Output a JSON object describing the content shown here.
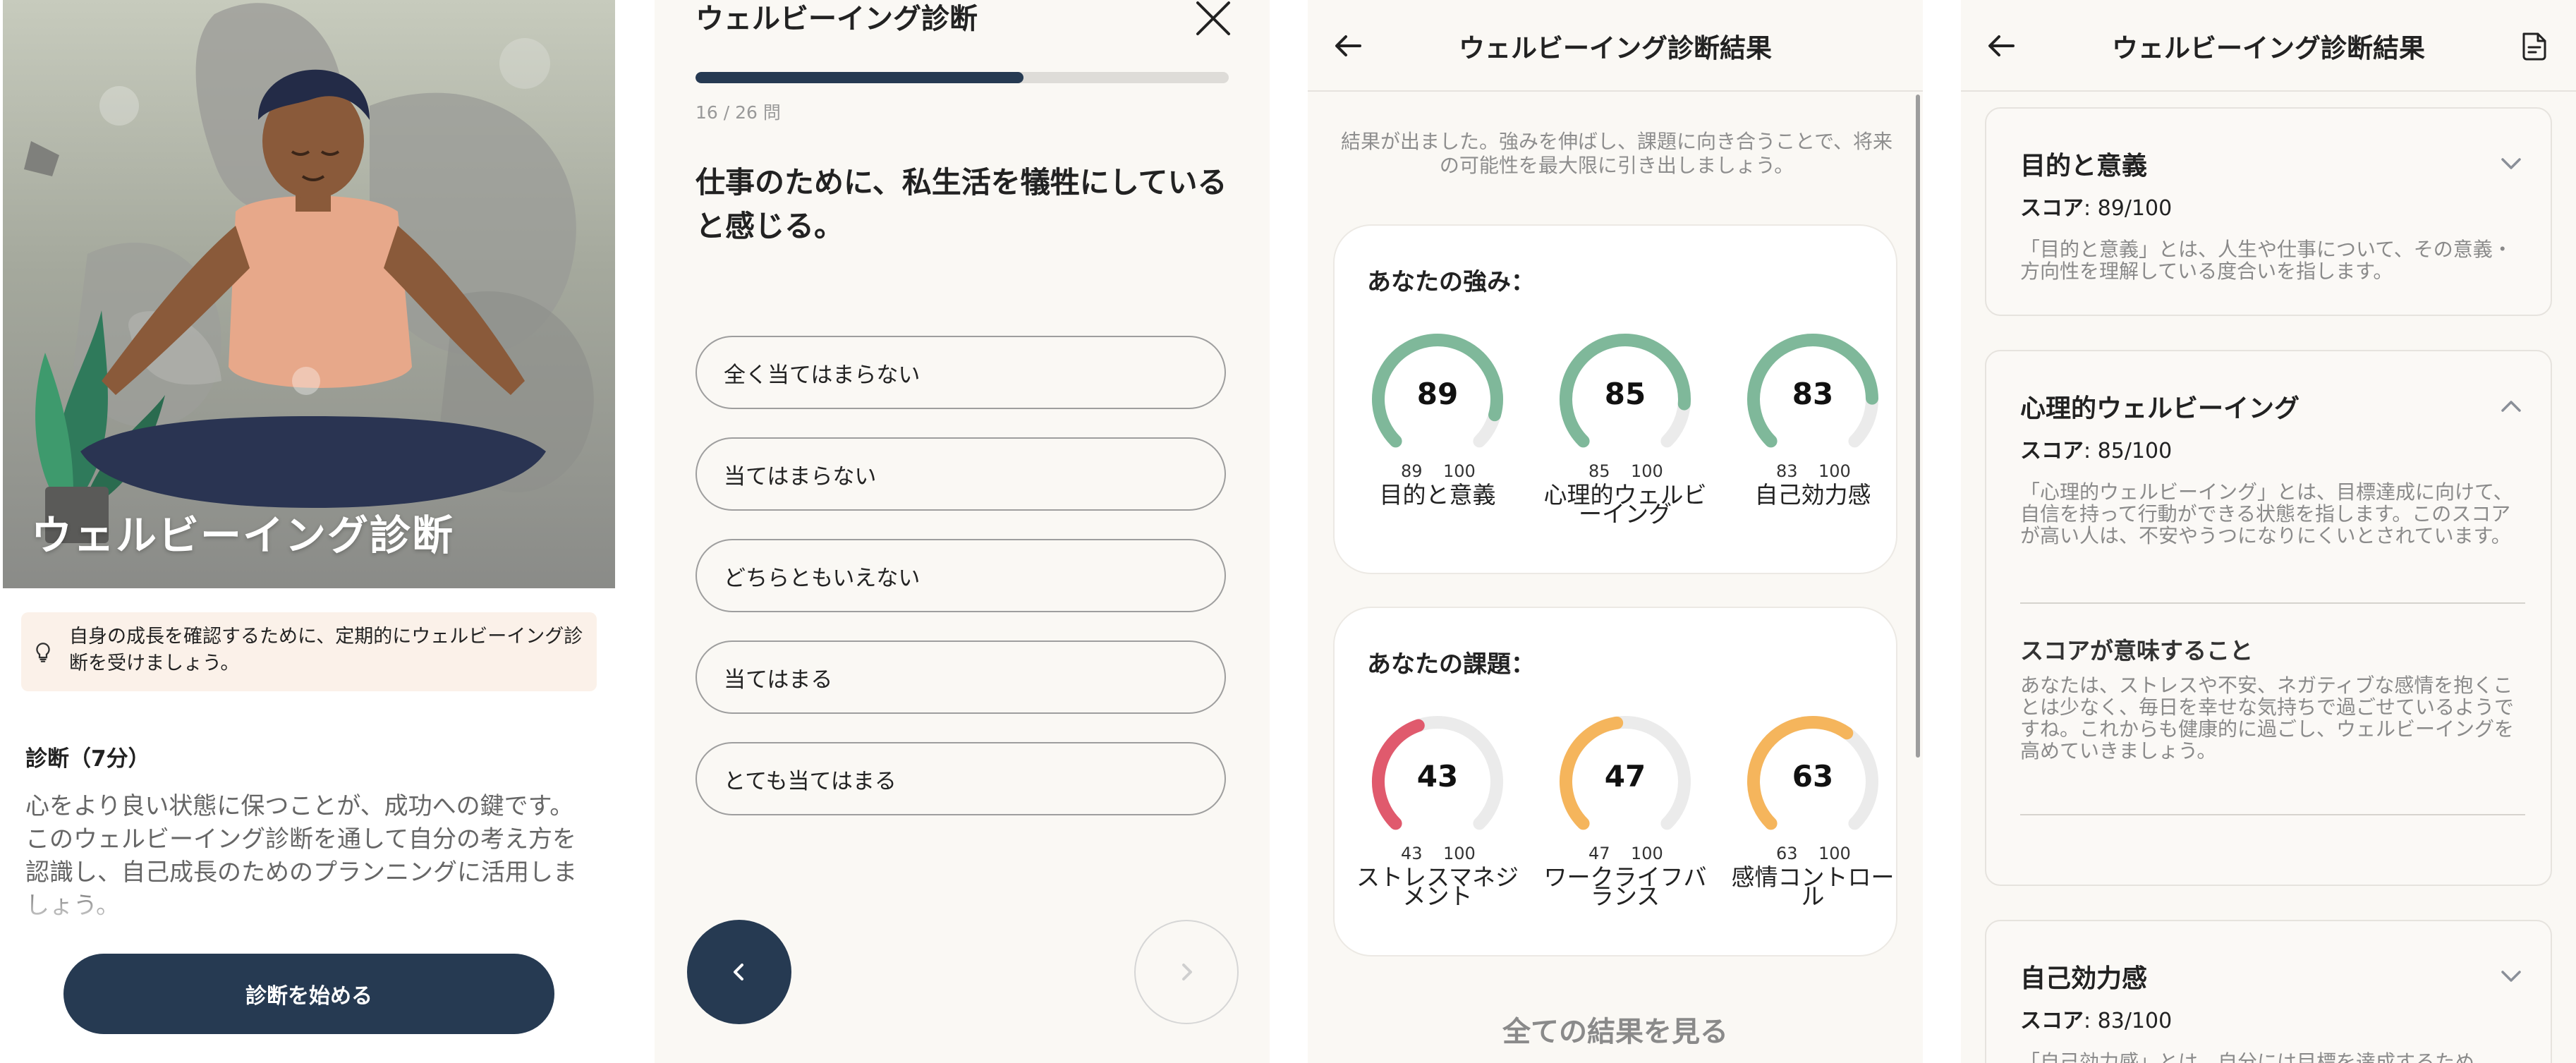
{
  "intro_screen": {
    "hero_title": "ウェルビーイング診断",
    "hint": "自身の成長を確認するために、定期的にウェルビーイング診断を受けましょう。",
    "section_title": "診断（7分）",
    "section_body": "心をより良い状態に保つことが、成功への鍵です。このウェルビーイング診断を通して自分の考え方を認識し、自己成長のためのプランニングに活用しましょう。",
    "start_button": "診断を始める"
  },
  "question_screen": {
    "title": "ウェルビーイング診断",
    "progress": {
      "current": 16,
      "total": 26,
      "label": "16 / 26 問"
    },
    "question": "仕事のために、私生活を犠牲にしていると感じる。",
    "options": [
      "全く当てはまらない",
      "当てはまらない",
      "どちらともいえない",
      "当てはまる",
      "とても当てはまる"
    ]
  },
  "result_screen": {
    "title": "ウェルビーイング診断結果",
    "intro": "結果が出ました。強みを伸ばし、課題に向き合うことで、将来の可能性を最大限に引き出しましょう。",
    "strengths_title": "あなたの強み：",
    "strengths": [
      {
        "value": "89",
        "min": "89",
        "max": "100",
        "label": "目的と意義",
        "color": "#7fb89a"
      },
      {
        "value": "85",
        "min": "85",
        "max": "100",
        "label": "心理的ウェルビーイング",
        "color": "#7fb89a"
      },
      {
        "value": "83",
        "min": "83",
        "max": "100",
        "label": "自己効力感",
        "color": "#7fb89a"
      }
    ],
    "challenges_title": "あなたの課題：",
    "challenges": [
      {
        "value": "43",
        "min": "43",
        "max": "100",
        "label": "ストレスマネジメント",
        "color": "#e05a6d"
      },
      {
        "value": "47",
        "min": "47",
        "max": "100",
        "label": "ワークライフバランス",
        "color": "#f5b55c"
      },
      {
        "value": "63",
        "min": "63",
        "max": "100",
        "label": "感情コントロール",
        "color": "#f5b55c"
      }
    ],
    "see_all": "全ての結果を見る",
    "gauge_track_color": "#ebebeb"
  },
  "detail_screen": {
    "title": "ウェルビーイング診断結果",
    "items": [
      {
        "title": "目的と意義",
        "score_label": "スコア",
        "score": ": 89/100",
        "desc": "「目的と意義」とは、人生や仕事について、その意義・方向性を理解している度合いを指します。",
        "expanded": false
      },
      {
        "title": "心理的ウェルビーイング",
        "score_label": "スコア",
        "score": ": 85/100",
        "desc": "「心理的ウェルビーイング」とは、目標達成に向けて、自信を持って行動ができる状態を指します。このスコアが高い人は、不安やうつになりにくいとされています。",
        "sub_title": "スコアが意味すること",
        "sub_desc": "あなたは、ストレスや不安、ネガティブな感情を抱くことは少なく、毎日を幸せな気持ちで過ごせているようですね。これからも健康的に過ごし、ウェルビーイングを高めていきましょう。",
        "expanded": true
      },
      {
        "title": "自己効力感",
        "score_label": "スコア",
        "score": ": 83/100",
        "desc": "「自己効力感」とは、自分には目標を達成するため",
        "expanded": false
      }
    ]
  },
  "colors": {
    "primary": "#263a52",
    "background": "#faf8f4"
  }
}
